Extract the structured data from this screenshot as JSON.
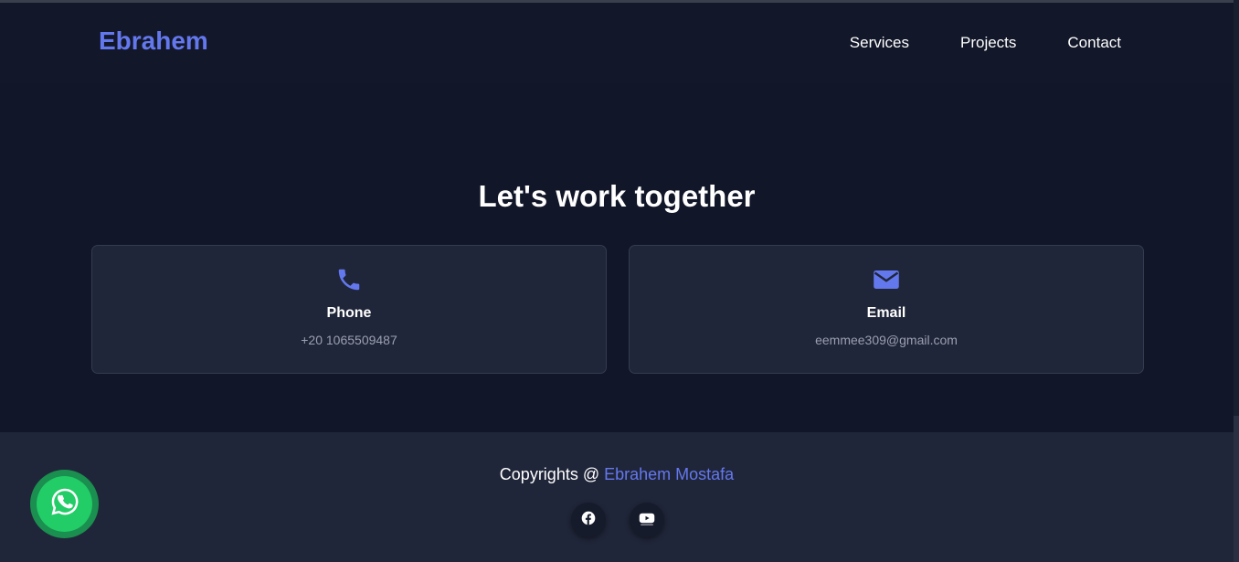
{
  "header": {
    "logo": "Ebrahem",
    "nav": [
      {
        "label": "Services"
      },
      {
        "label": "Projects"
      },
      {
        "label": "Contact"
      }
    ]
  },
  "contact": {
    "title": "Let's work together",
    "cards": [
      {
        "icon": "phone-icon",
        "title": "Phone",
        "value": "+20 1065509487"
      },
      {
        "icon": "envelope-icon",
        "title": "Email",
        "value": "eemmee309@gmail.com"
      }
    ]
  },
  "footer": {
    "copyright_prefix": "Copyrights @ ",
    "author": "Ebrahem Mostafa",
    "socials": [
      {
        "icon": "facebook-icon"
      },
      {
        "icon": "youtube-icon"
      }
    ]
  },
  "floating": {
    "icon": "whatsapp-icon"
  },
  "colors": {
    "accent": "#6478ee",
    "background": "#111628",
    "card": "#202639",
    "whatsapp": "#22cc66"
  }
}
